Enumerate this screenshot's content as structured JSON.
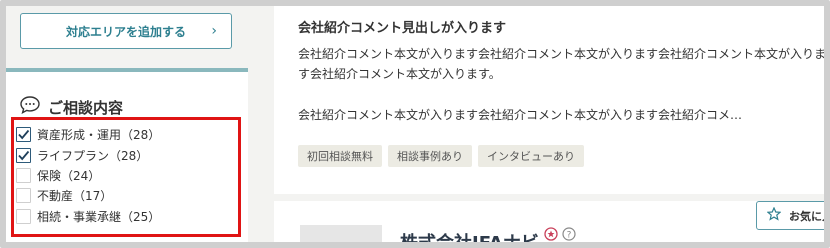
{
  "sidebar": {
    "area_button_label": "対応エリアを追加する",
    "consult_title": "ご相談内容",
    "options": [
      {
        "label": "資産形成・運用（28）",
        "checked": true
      },
      {
        "label": "ライフプラン（28）",
        "checked": true
      },
      {
        "label": "保険（24）",
        "checked": false
      },
      {
        "label": "不動産（17）",
        "checked": false
      },
      {
        "label": "相続・事業承継（25）",
        "checked": false
      }
    ]
  },
  "card": {
    "comment_heading": "会社紹介コメント見出しが入ります",
    "comment_body": "会社紹介コメント本文が入ります会社紹介コメント本文が入ります会社紹介コメント本文が入ります会社紹介コメント本文が入ります。",
    "comment_body2": "会社紹介コメント本文が入ります会社紹介コメント本文が入ります会社紹介コメ…",
    "tags": [
      "初回相談無料",
      "相談事例あり",
      "インタビューあり"
    ]
  },
  "card2": {
    "company_name": "株式会社IFAナビ",
    "favorite_label": "お気に入り"
  },
  "colors": {
    "accent": "#2d7f8f",
    "highlight_red": "#e01414",
    "tag_bg": "#ecebe3"
  }
}
